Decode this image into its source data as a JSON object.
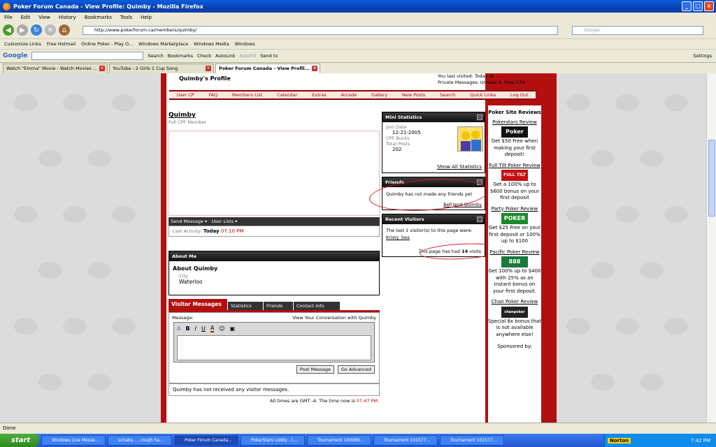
{
  "window": {
    "title": "Poker Forum Canada - View Profile: Quimby - Mozilla Firefox"
  },
  "menu": [
    "File",
    "Edit",
    "View",
    "History",
    "Bookmarks",
    "Tools",
    "Help"
  ],
  "nav": {
    "url": "http://www.pokerforum.ca/members/quimby/",
    "search_placeholder": "Google"
  },
  "bookmarks": [
    "Customize Links",
    "Free Hotmail",
    "Online Poker - Play O...",
    "Windows Marketplace",
    "Windows Media",
    "Windows"
  ],
  "google_bar": {
    "search_label": "Search",
    "bookmarks_label": "Bookmarks",
    "check_label": "Check",
    "autolink_label": "AutoLink",
    "autofill_label": "AutoFill",
    "sendto_label": "Send to",
    "settings_label": "Settings"
  },
  "tabs": [
    {
      "label": "Watch \"Emma\" Movie - Watch Movies ..."
    },
    {
      "label": "YouTube - 2 Girls 1 Cup Song"
    },
    {
      "label": "Poker Forum Canada - View Profil..."
    }
  ],
  "header": {
    "profile_title": "Quimby's Profile",
    "last_visited_label": "You last visited: Today at",
    "last_visited_time": "04:51 PM",
    "private_messages": "Private Messages: Unread 4, Total 574."
  },
  "forum_nav": [
    "User CP",
    "FAQ",
    "Members List",
    "Calendar",
    "Extras",
    "Arcade",
    "Gallery",
    "New Posts",
    "Search",
    "Quick Links",
    "Log Out"
  ],
  "profile": {
    "username": "Quimby",
    "rank": "Full CPF Member",
    "send_message": "Send Message",
    "user_lists": "User Lists",
    "last_activity_label": "Last Activity:",
    "last_activity_day": "Today",
    "last_activity_time": "07:10 PM"
  },
  "about": {
    "header": "About Me",
    "title": "About Quimby",
    "city_label": "City",
    "city": "Waterloo"
  },
  "visitor_messages": {
    "tab_active": "Visitor Messages",
    "tabs": [
      "Statistics",
      "Friends",
      "Contact Info"
    ],
    "message_label": "Message:",
    "conversation_link": "View Your Conversation with Quimby",
    "post_button": "Post Message",
    "advanced_button": "Go Advanced",
    "empty": "Quimby has not received any visitor messages."
  },
  "footer": {
    "text": "All times are GMT -4. The time now is",
    "time": "07:47 PM."
  },
  "mini_stats": {
    "header": "Mini Statistics",
    "join_label": "Join Date",
    "join_date": "12-21-2005",
    "bucks_label": "CPF Bucks",
    "posts_label": "Total Posts",
    "posts": "202",
    "show_all": "Show All Statistics"
  },
  "friends": {
    "header": "Friends",
    "text": "Quimby has not made any friends yet",
    "befriend": "Befriend Quimby"
  },
  "recent_visitors": {
    "header": "Recent Visitors",
    "text": "The last 1 visitor(s) to this page were:",
    "visitor": "Kristy_Sea",
    "visits_prefix": "This page has had",
    "visits_count": "14",
    "visits_suffix": "visits"
  },
  "sidebar": {
    "title": "Poker Site Reviews",
    "ads": [
      {
        "link": "Pokerstars Review",
        "logo": "Poker",
        "text": "Get $50 Free when making your first deposit!"
      },
      {
        "link": "Full Tilt Poker Review",
        "logo": "FULL TILT",
        "text": "Get a 100% up to $600 bonus on your first deposit"
      },
      {
        "link": "Party Poker Review",
        "logo": "POKER",
        "text": "Get $25 Free on your first deposit or 100% up to $100"
      },
      {
        "link": "Pacific Poker Review",
        "logo": "888",
        "text": "Get 100% up to $400 with 25% as an instant bonus on your first deposit."
      },
      {
        "link": "Chan Poker Review",
        "logo": "chanpoker",
        "text": "Special 8x bonus that is not available anywhere else!"
      }
    ],
    "sponsored": "Sponsored by:"
  },
  "status": {
    "text": "Done"
  },
  "taskbar": {
    "start": "start",
    "items": [
      "Windows Live Messe...",
      "schabs......rough ha...",
      "Poker Forum Canada...",
      "PokerStars Lobby - L...",
      "Tournament 100069...",
      "Tournament 101577...",
      "Tournament 101577...",
      "Tournament 101577..."
    ],
    "norton": "Norton",
    "clock": "7:42 PM"
  }
}
